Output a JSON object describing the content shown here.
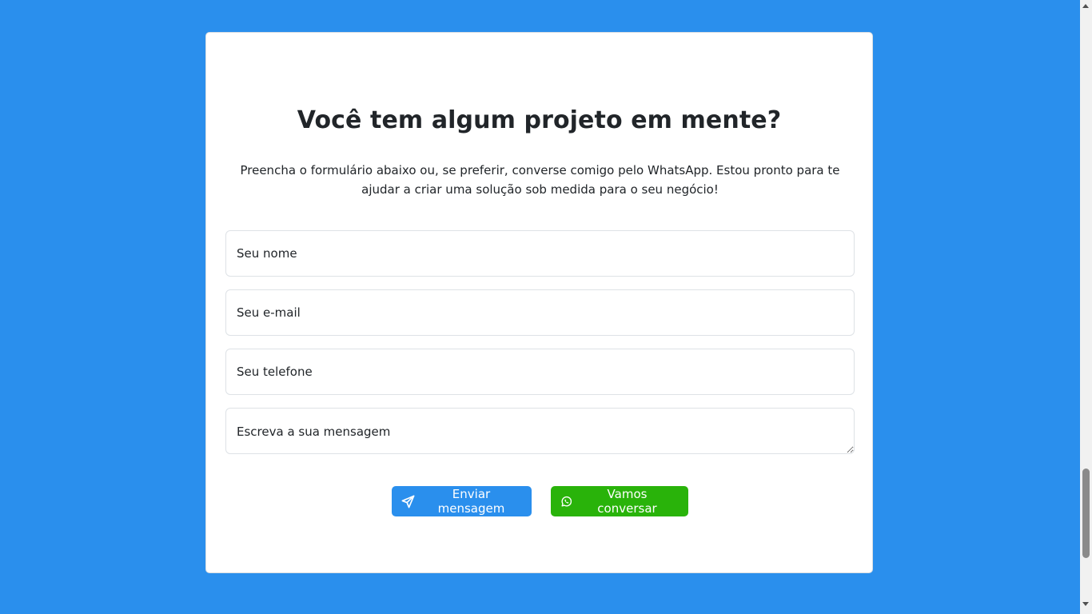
{
  "contact": {
    "title": "Você tem algum projeto em mente?",
    "subtitle": "Preencha o formulário abaixo ou, se preferir, converse comigo pelo WhatsApp. Estou pronto para te ajudar a criar uma solução sob medida para o seu negócio!",
    "form": {
      "name_placeholder": "Seu nome",
      "email_placeholder": "Seu e-mail",
      "phone_placeholder": "Seu telefone",
      "message_placeholder": "Escreva a sua mensagem"
    },
    "buttons": {
      "send_label": "Enviar mensagem",
      "send_icon": "paper-plane-icon",
      "whatsapp_label": "Vamos conversar",
      "whatsapp_icon": "whatsapp-icon"
    }
  },
  "colors": {
    "background": "#2a8fed",
    "primary_button": "#2a8fed",
    "whatsapp_button": "#29b30a",
    "card": "#ffffff"
  }
}
